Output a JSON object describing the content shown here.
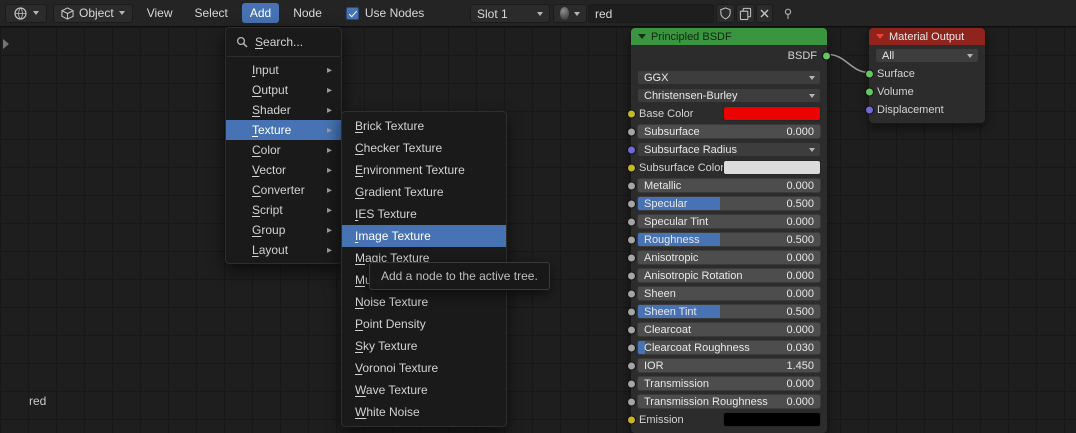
{
  "topbar": {
    "shader_type_label": "Object",
    "menus": [
      "View",
      "Select",
      "Add",
      "Node"
    ],
    "active_menu": "Add",
    "use_nodes_label": "Use Nodes",
    "slot_label": "Slot 1",
    "material_name": "red"
  },
  "add_menu": {
    "search_label": "Search...",
    "items": [
      "Input",
      "Output",
      "Shader",
      "Texture",
      "Color",
      "Vector",
      "Converter",
      "Script",
      "Group",
      "Layout"
    ],
    "active_item": "Texture"
  },
  "texture_submenu": {
    "items": [
      "Brick Texture",
      "Checker Texture",
      "Environment Texture",
      "Gradient Texture",
      "IES Texture",
      "Image Texture",
      "Magic Texture",
      "Musgrave Texture",
      "Noise Texture",
      "Point Density",
      "Sky Texture",
      "Voronoi Texture",
      "Wave Texture",
      "White Noise"
    ],
    "active_item": "Image Texture"
  },
  "tooltip_text": "Add a node to the active tree.",
  "principled_node": {
    "title": "Principled BSDF",
    "output_label": "BSDF",
    "output_socket_color": "#63c763",
    "distribution": "GGX",
    "subsurface_method": "Christensen-Burley",
    "rows": [
      {
        "label": "Base Color",
        "type": "color",
        "socket_color": "#c8b629",
        "swatch_color": "#ed0000"
      },
      {
        "label": "Subsurface",
        "type": "slider",
        "value": "0.000",
        "fill": 0,
        "socket_color": "#a5a5a5"
      },
      {
        "label": "Subsurface Radius",
        "type": "vector",
        "socket_color": "#6e6ad8"
      },
      {
        "label": "Subsurface Color",
        "type": "color",
        "socket_color": "#c8b629",
        "swatch_color": "#dcdcdc"
      },
      {
        "label": "Metallic",
        "type": "slider",
        "value": "0.000",
        "fill": 0,
        "socket_color": "#a5a5a5"
      },
      {
        "label": "Specular",
        "type": "slider",
        "value": "0.500",
        "fill": 45,
        "socket_color": "#a5a5a5"
      },
      {
        "label": "Specular Tint",
        "type": "slider",
        "value": "0.000",
        "fill": 0,
        "socket_color": "#a5a5a5"
      },
      {
        "label": "Roughness",
        "type": "slider",
        "value": "0.500",
        "fill": 45,
        "socket_color": "#a5a5a5"
      },
      {
        "label": "Anisotropic",
        "type": "slider",
        "value": "0.000",
        "fill": 0,
        "socket_color": "#a5a5a5"
      },
      {
        "label": "Anisotropic Rotation",
        "type": "slider",
        "value": "0.000",
        "fill": 0,
        "socket_color": "#a5a5a5"
      },
      {
        "label": "Sheen",
        "type": "slider",
        "value": "0.000",
        "fill": 0,
        "socket_color": "#a5a5a5"
      },
      {
        "label": "Sheen Tint",
        "type": "slider",
        "value": "0.500",
        "fill": 45,
        "socket_color": "#a5a5a5"
      },
      {
        "label": "Clearcoat",
        "type": "slider",
        "value": "0.000",
        "fill": 0,
        "socket_color": "#a5a5a5"
      },
      {
        "label": "Clearcoat Roughness",
        "type": "slider",
        "value": "0.030",
        "fill": 4,
        "socket_color": "#a5a5a5"
      },
      {
        "label": "IOR",
        "type": "slider",
        "value": "1.450",
        "fill": 0,
        "socket_color": "#a5a5a5"
      },
      {
        "label": "Transmission",
        "type": "slider",
        "value": "0.000",
        "fill": 0,
        "socket_color": "#a5a5a5"
      },
      {
        "label": "Transmission Roughness",
        "type": "slider",
        "value": "0.000",
        "fill": 0,
        "socket_color": "#a5a5a5"
      },
      {
        "label": "Emission",
        "type": "color",
        "socket_color": "#c8b629",
        "swatch_color": "#000000"
      }
    ]
  },
  "output_node": {
    "title": "Material Output",
    "target": "All",
    "inputs": [
      {
        "label": "Surface",
        "socket_color": "#63c763"
      },
      {
        "label": "Volume",
        "socket_color": "#63c763"
      },
      {
        "label": "Displacement",
        "socket_color": "#6e6ad8"
      }
    ]
  },
  "canvas_label": "red",
  "colors": {
    "accent": "#4772b3",
    "header_green": "#3a9440",
    "header_red": "#8e241c"
  }
}
